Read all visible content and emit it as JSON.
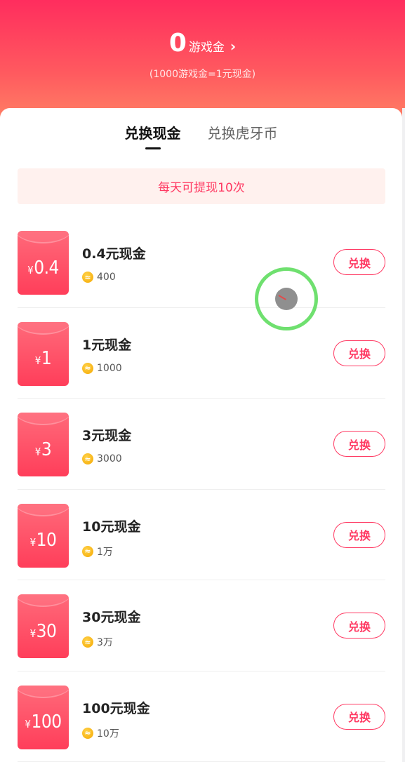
{
  "header": {
    "balance": "0",
    "balance_unit": "游戏金",
    "chevron": "›",
    "rate_note": "(1000游戏金=1元现金)"
  },
  "tabs": [
    {
      "label": "兑换现金",
      "active": true
    },
    {
      "label": "兑换虎牙币",
      "active": false
    }
  ],
  "notice": "每天可提现10次",
  "items": [
    {
      "yen": "¥",
      "amount": "0.4",
      "title": "0.4元现金",
      "cost": "400",
      "button": "兑换"
    },
    {
      "yen": "¥",
      "amount": "1",
      "title": "1元现金",
      "cost": "1000",
      "button": "兑换"
    },
    {
      "yen": "¥",
      "amount": "3",
      "title": "3元现金",
      "cost": "3000",
      "button": "兑换"
    },
    {
      "yen": "¥",
      "amount": "10",
      "title": "10元现金",
      "cost": "1万",
      "button": "兑换"
    },
    {
      "yen": "¥",
      "amount": "30",
      "title": "30元现金",
      "cost": "3万",
      "button": "兑换"
    },
    {
      "yen": "¥",
      "amount": "100",
      "title": "100元现金",
      "cost": "10万",
      "button": "兑换"
    }
  ],
  "colors": {
    "accent": "#ff3a63",
    "header_top": "#ff2d5e",
    "header_bottom": "#ff8a66",
    "coin": "#f5a800",
    "cursor_ring": "#6fe06f"
  },
  "icons": {
    "chevron": "chevron-right-icon",
    "coin": "game-coin-icon"
  }
}
